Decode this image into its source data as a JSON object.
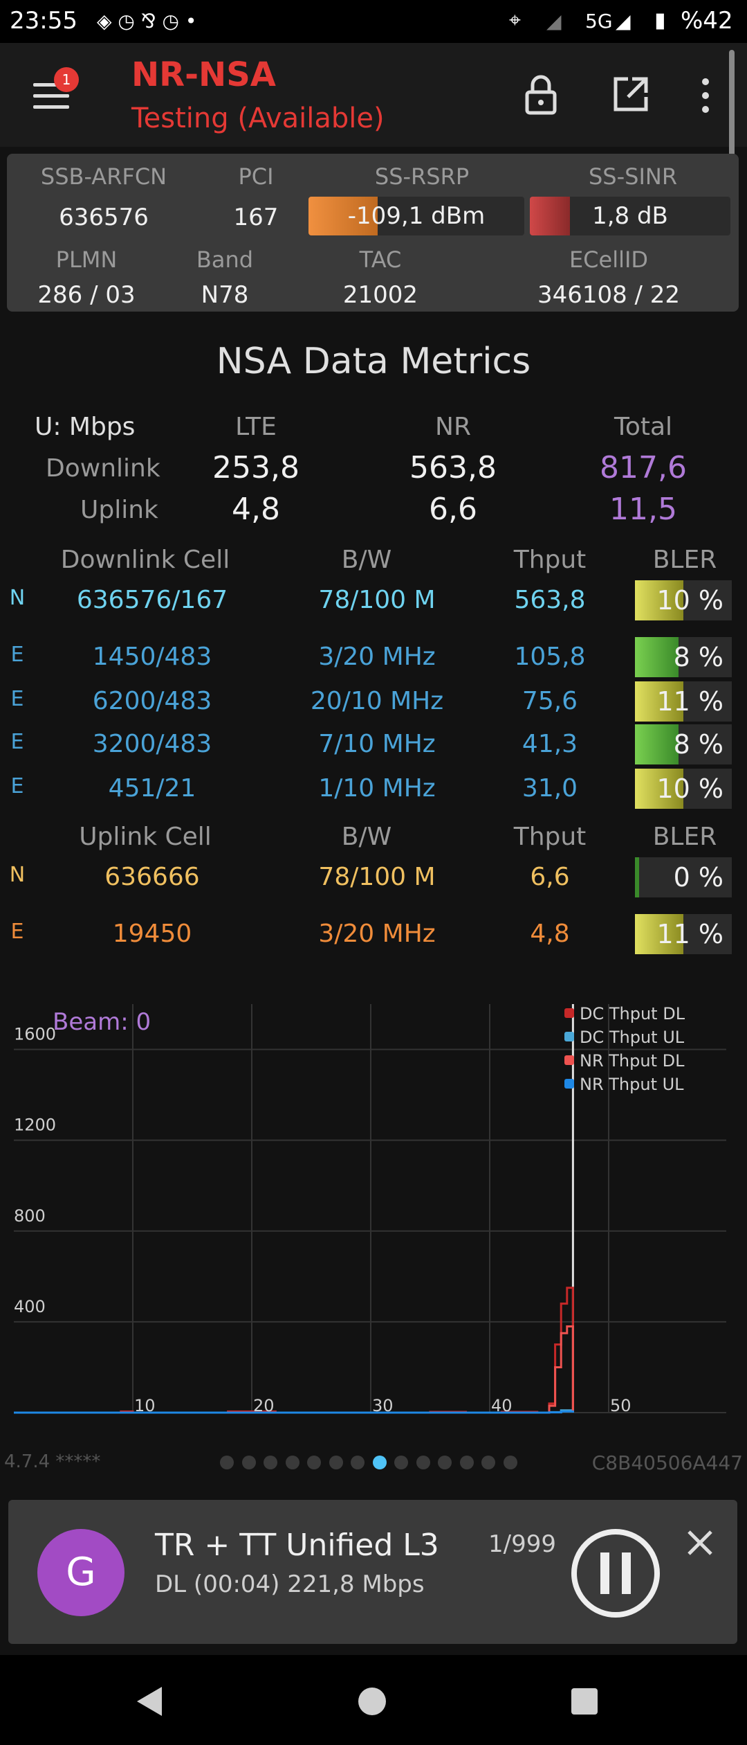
{
  "status_bar": {
    "time": "23:55",
    "network": "5G",
    "battery": "%42"
  },
  "app_bar": {
    "title": "NR-NSA",
    "subtitle": "Testing (Available)",
    "badge_count": "1"
  },
  "cell_info": {
    "labels": {
      "ssb_arfcn": "SSB-ARFCN",
      "pci": "PCI",
      "ss_rsrp": "SS-RSRP",
      "ss_sinr": "SS-SINR",
      "plmn": "PLMN",
      "band": "Band",
      "tac": "TAC",
      "ecellid": "ECellID"
    },
    "ssb_arfcn": "636576",
    "pci": "167",
    "ss_rsrp": "-109,1 dBm",
    "ss_sinr": "1,8 dB",
    "plmn": "286 / 03",
    "band": "N78",
    "tac": "21002",
    "ecellid": "346108 / 22",
    "rsrp_fill": 0.32,
    "sinr_fill": 0.2
  },
  "metrics": {
    "title": "NSA Data Metrics",
    "units_label": "U: Mbps",
    "headers": {
      "lte": "LTE",
      "nr": "NR",
      "total": "Total"
    },
    "downlink": {
      "label": "Downlink",
      "lte": "253,8",
      "nr": "563,8",
      "total": "817,6"
    },
    "uplink": {
      "label": "Uplink",
      "lte": "4,8",
      "nr": "6,6",
      "total": "11,5"
    }
  },
  "downlink_cells": {
    "headers": {
      "cell": "Downlink Cell",
      "bw": "B/W",
      "thput": "Thput",
      "bler": "BLER"
    },
    "rows": [
      {
        "type": "N",
        "cell": "636576/167",
        "bw": "78/100 M",
        "thput": "563,8",
        "bler": "10 %",
        "level": 0.5
      },
      {
        "type": "E",
        "cell": "1450/483",
        "bw": "3/20 MHz",
        "thput": "105,8",
        "bler": "8 %",
        "level": 0.45
      },
      {
        "type": "E",
        "cell": "6200/483",
        "bw": "20/10 MHz",
        "thput": "75,6",
        "bler": "11 %",
        "level": 0.5
      },
      {
        "type": "E",
        "cell": "3200/483",
        "bw": "7/10 MHz",
        "thput": "41,3",
        "bler": "8 %",
        "level": 0.45
      },
      {
        "type": "E",
        "cell": "451/21",
        "bw": "1/10 MHz",
        "thput": "31,0",
        "bler": "10 %",
        "level": 0.5
      }
    ]
  },
  "uplink_cells": {
    "headers": {
      "cell": "Uplink Cell",
      "bw": "B/W",
      "thput": "Thput",
      "bler": "BLER"
    },
    "rows": [
      {
        "type": "N",
        "cell": "636666",
        "bw": "78/100 M",
        "thput": "6,6",
        "bler": "0 %",
        "level": 0.04
      },
      {
        "type": "E",
        "cell": "19450",
        "bw": "3/20 MHz",
        "thput": "4,8",
        "bler": "11 %",
        "level": 0.5
      }
    ]
  },
  "chart_data": {
    "type": "line",
    "title": "",
    "annotation": "Beam: 0",
    "xlim": [
      0,
      50
    ],
    "ylim": [
      0,
      1800
    ],
    "x_ticks": [
      "10",
      "20",
      "30",
      "40",
      "50"
    ],
    "y_ticks": [
      "400",
      "800",
      "1200",
      "1600"
    ],
    "grid": true,
    "legend_position": "top-right",
    "series": [
      {
        "name": "DC Thput DL",
        "color": "#c62828",
        "x": [
          0,
          5,
          8,
          9,
          10,
          15,
          18,
          22,
          30,
          32,
          35,
          38,
          40,
          41,
          44,
          45,
          45.5,
          46,
          46.5,
          47
        ],
        "y": [
          0,
          0,
          0,
          5,
          0,
          0,
          5,
          0,
          0,
          0,
          3,
          0,
          0,
          3,
          0,
          40,
          300,
          480,
          550,
          0
        ]
      },
      {
        "name": "DC Thput UL",
        "color": "#4aa8d8",
        "x": [
          0,
          10,
          20,
          30,
          40,
          45,
          46,
          47
        ],
        "y": [
          0,
          0,
          0,
          0,
          0,
          2,
          10,
          0
        ]
      },
      {
        "name": "NR Thput DL",
        "color": "#ef5350",
        "x": [
          0,
          5,
          10,
          20,
          30,
          40,
          44,
          45,
          45.5,
          46,
          46.5,
          47
        ],
        "y": [
          0,
          0,
          0,
          0,
          0,
          0,
          0,
          30,
          200,
          350,
          380,
          0
        ]
      },
      {
        "name": "NR Thput UL",
        "color": "#1e88e5",
        "x": [
          0,
          10,
          20,
          30,
          40,
          45,
          46,
          47
        ],
        "y": [
          0,
          0,
          0,
          0,
          0,
          1,
          5,
          0
        ]
      }
    ]
  },
  "footer": {
    "version": "4.7.4 *****",
    "device_id": "C8B40506A447",
    "pages": 14,
    "active_page": 8
  },
  "notification": {
    "avatar_letter": "G",
    "title": "TR + TT Unified L3",
    "counter": "1/999",
    "subtitle": "DL (00:04) 221,8 Mbps"
  },
  "colors": {
    "nr_row": "#6fd3f0",
    "lte_row": "#4aa3d8",
    "ul_nr_row": "#f0c060",
    "ul_lte_row": "#f08c3a",
    "total": "#b07ad8",
    "accent_red": "#e53935"
  }
}
